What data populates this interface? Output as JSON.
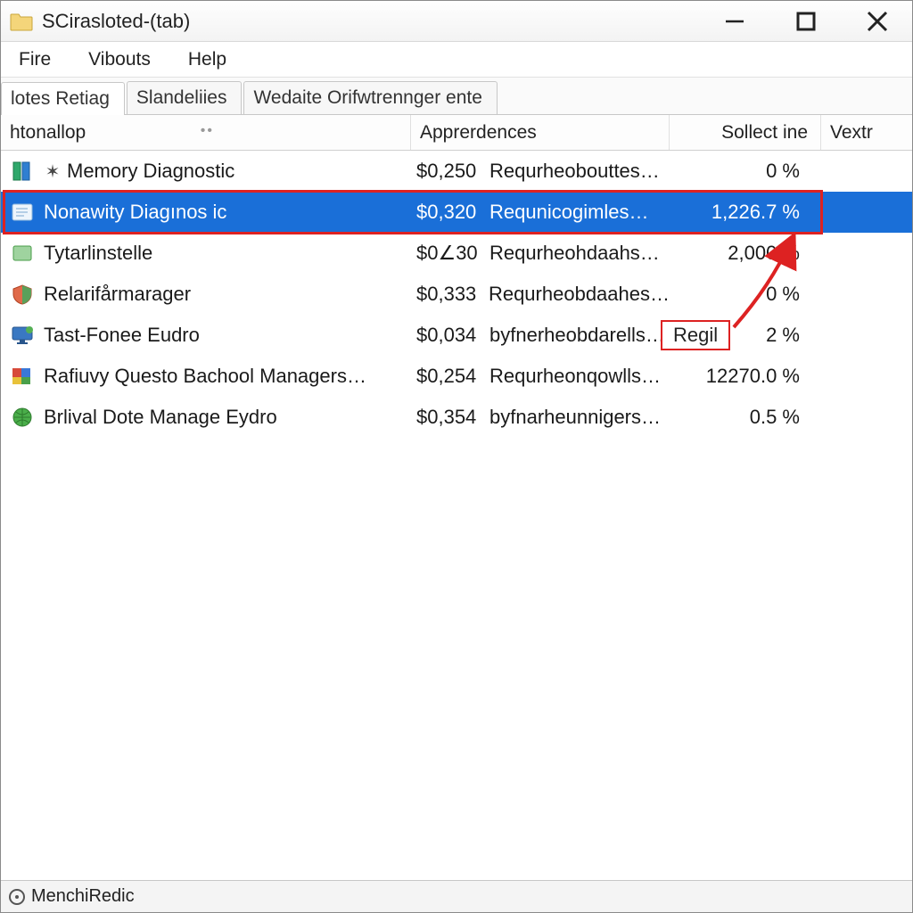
{
  "window": {
    "title": "SCirasloted-(tab)"
  },
  "menubar": {
    "items": [
      "Fire",
      "Vibouts",
      "Help"
    ]
  },
  "tabs": {
    "items": [
      {
        "label": "lotes Retiag",
        "active": true
      },
      {
        "label": "Slandeliies",
        "active": false
      },
      {
        "label": "Wedaite Orifwtrennger ente",
        "active": false
      }
    ]
  },
  "columns": {
    "name": "htonallop",
    "app": "Apprerdences",
    "soll": "Sollect ine",
    "vex": "Vextr"
  },
  "rows": [
    {
      "icon": "memory",
      "glyph": "✶",
      "name": "Memory Diagnostic",
      "amount": "$0,250",
      "desc": "Requrheobouttes…",
      "pct": "0 %",
      "selected": false
    },
    {
      "icon": "doc",
      "glyph": "",
      "name": "Nonawity Diagınos ic",
      "amount": "$0,320",
      "desc": "Requnicogimles…",
      "pct": "1,226.7 %",
      "selected": true
    },
    {
      "icon": "app",
      "glyph": "",
      "name": "Tytarlinstelle",
      "amount": "$0∠30",
      "desc": "Requrheohdaahs…",
      "pct": "2,000   %",
      "selected": false
    },
    {
      "icon": "shield",
      "glyph": "",
      "name": "Relarifårmarager",
      "amount": "$0,333",
      "desc": "Requrheobdaahes…",
      "pct": "0 %",
      "selected": false
    },
    {
      "icon": "monitor",
      "glyph": "",
      "name": "Tast-Fonee Eudro",
      "amount": "$0,034",
      "desc": "byfnerheobdarells…",
      "pct": "2 %",
      "selected": false
    },
    {
      "icon": "puzzle",
      "glyph": "",
      "name": "Rafiuvy Questo Bachool Managers…",
      "amount": "$0,254",
      "desc": "Requrheonqowlls…",
      "pct": "12270.0 %",
      "selected": false
    },
    {
      "icon": "globe",
      "glyph": "",
      "name": "Brlival Dote Manage Eydro",
      "amount": "$0,354",
      "desc": "byfnarheunnigers…",
      "pct": "0.5 %",
      "selected": false
    }
  ],
  "annotations": {
    "callout_label": "Regil"
  },
  "statusbar": {
    "text": "MenchiRedic"
  }
}
